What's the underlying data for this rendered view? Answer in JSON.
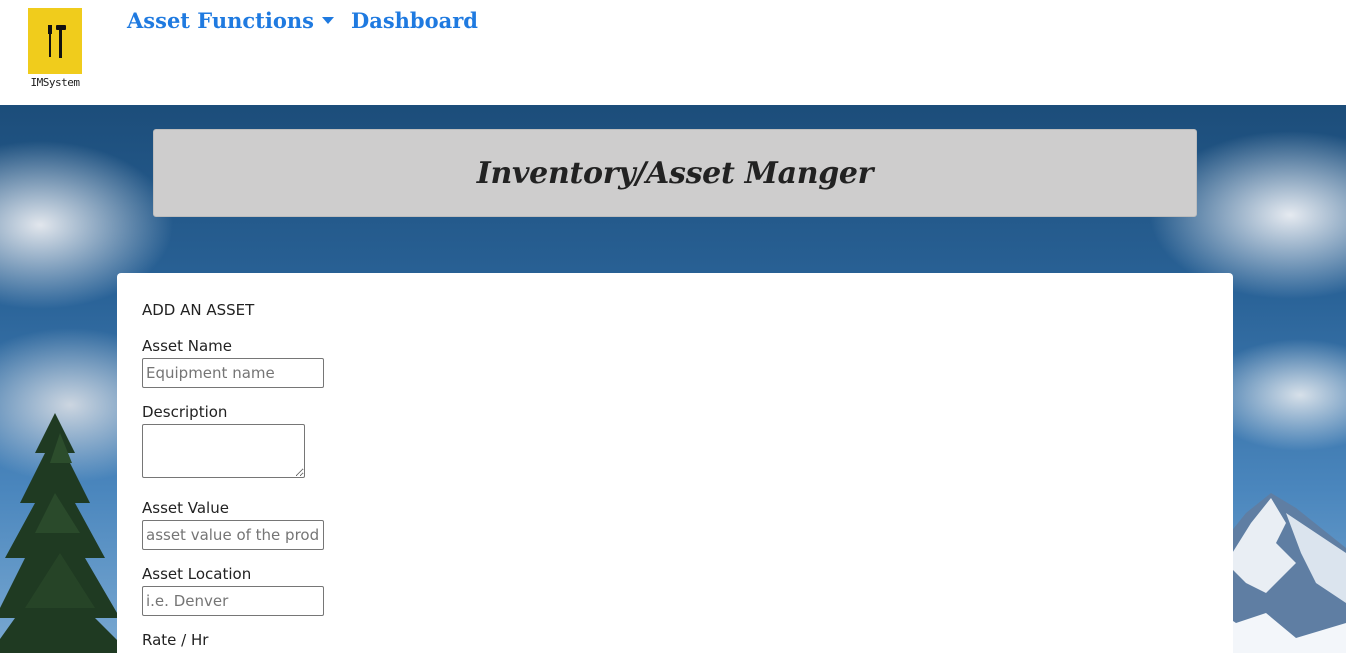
{
  "navbar": {
    "logo_text": "IMSystem",
    "asset_functions_label": "Asset Functions",
    "dashboard_label": "Dashboard",
    "link_color": "#1f7ae0",
    "logo_color": "#f0cc1c"
  },
  "banner": {
    "title": "Inventory/Asset Manger"
  },
  "form": {
    "heading": "ADD AN ASSET",
    "fields": {
      "name": {
        "label": "Asset Name",
        "placeholder": "Equipment name"
      },
      "description": {
        "label": "Description"
      },
      "value": {
        "label": "Asset Value",
        "placeholder": "asset value of the product"
      },
      "location": {
        "label": "Asset Location",
        "placeholder": "i.e. Denver"
      },
      "rate": {
        "label": "Rate / Hr"
      }
    }
  }
}
